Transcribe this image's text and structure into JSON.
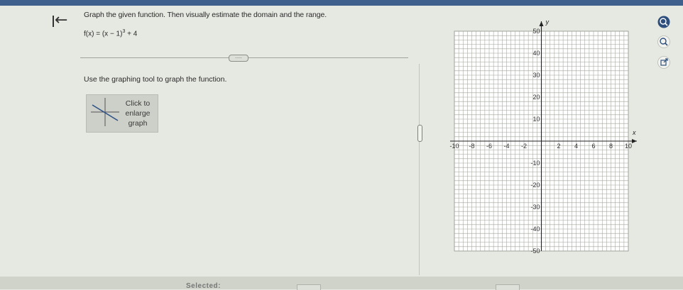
{
  "header": {
    "instruction": "Graph the given function. Then visually estimate the domain and the range.",
    "function_base": "f(x) = (x − 1)",
    "function_exponent": "3",
    "function_tail": " + 4"
  },
  "main": {
    "tool_instruction": "Use the graphing tool to graph the function.",
    "enlarge_lines": [
      "Click to",
      "enlarge",
      "graph"
    ],
    "more_label": "....."
  },
  "graph": {
    "x_axis_label": "x",
    "y_axis_label": "y",
    "x_ticks": [
      "-10",
      "-8",
      "-6",
      "-4",
      "-2",
      "2",
      "4",
      "6",
      "8",
      "10"
    ],
    "y_ticks": [
      "50",
      "40",
      "30",
      "20",
      "10",
      "-10",
      "-20",
      "-30",
      "-40",
      "-50"
    ],
    "x_range": [
      -10,
      10
    ],
    "y_range": [
      -50,
      50
    ]
  },
  "side_tools": [
    "zoom-in-icon",
    "zoom-out-icon",
    "open-external-icon"
  ],
  "footer": {
    "selected_label": "Selected:"
  },
  "colors": {
    "accent": "#3f5f8c",
    "background": "#e6e8e2",
    "grid": "#8c9087"
  }
}
